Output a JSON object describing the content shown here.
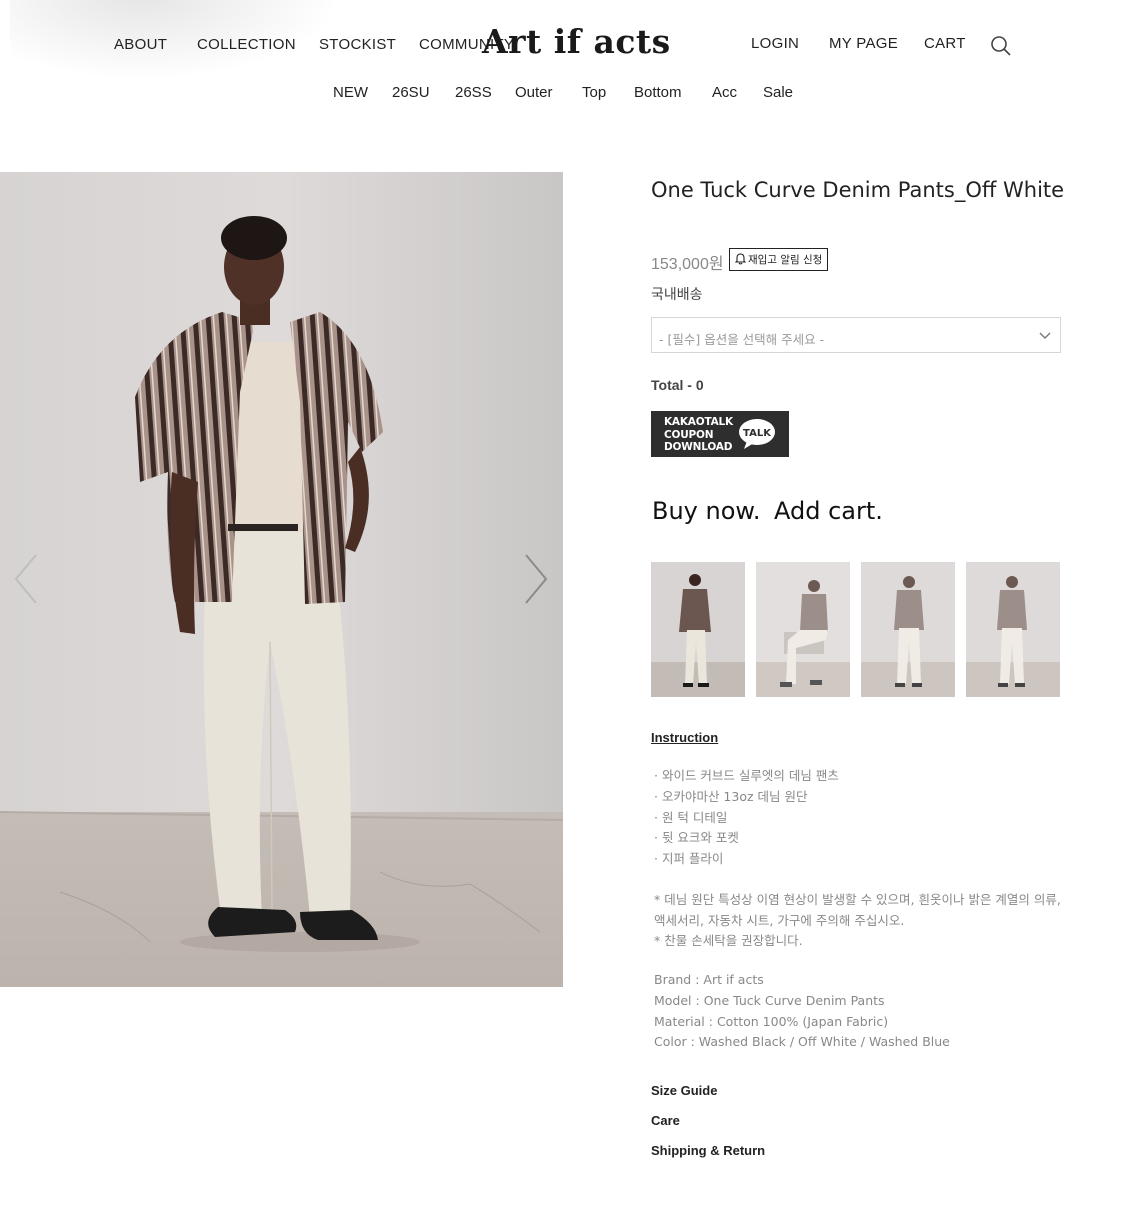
{
  "header": {
    "logo": "Art if acts",
    "left_nav": [
      "ABOUT",
      "COLLECTION",
      "STOCKIST",
      "COMMUNITY"
    ],
    "right_nav": [
      "LOGIN",
      "MY PAGE",
      "CART"
    ],
    "search_icon": "search-icon"
  },
  "sub_nav": [
    "NEW",
    "26SU",
    "26SS",
    "Outer",
    "Top",
    "Bottom",
    "Acc",
    "Sale"
  ],
  "product": {
    "title": "One Tuck Curve Denim Pants_Off White",
    "price": "153,000원",
    "restock_label": "재입고 알림 신청",
    "shipping": "국내배송",
    "option_placeholder": "- [필수] 옵션을 선택해 주세요 -",
    "total": "Total - 0",
    "kakao_lines": [
      "KAKAOTALK",
      "COUPON",
      "DOWNLOAD"
    ],
    "kakao_talk": "TALK",
    "buy_now": "Buy now.",
    "add_cart": "Add cart."
  },
  "instruction": {
    "title": "Instruction",
    "features": [
      "· 와이드 커브드 실루엣의 데님 팬츠",
      "· 오카야마산 13oz 데님 원단",
      "· 원 턱 디테일",
      "· 뒷 요크와 포켓",
      "· 지퍼 플라이"
    ],
    "notes": [
      "* 데님 원단 특성상 이염 현상이 발생할 수 있으며, 흰옷이나 밝은 계열의 의류,",
      "액세서리, 자동차 시트, 가구에 주의해 주십시오.",
      "* 찬물 손세탁을 권장합니다."
    ],
    "specs": [
      "Brand : Art if acts",
      "Model : One Tuck Curve Denim Pants",
      "Material : Cotton 100% (Japan Fabric)",
      "Color : Washed Black / Off White / Washed Blue"
    ]
  },
  "bottom_links": [
    "Size Guide",
    "Care",
    "Shipping & Return"
  ],
  "colors": {
    "text": "#222222",
    "muted": "#888888",
    "banner_bg": "#2e2e2e",
    "image_bg": "#d9d5d2"
  }
}
